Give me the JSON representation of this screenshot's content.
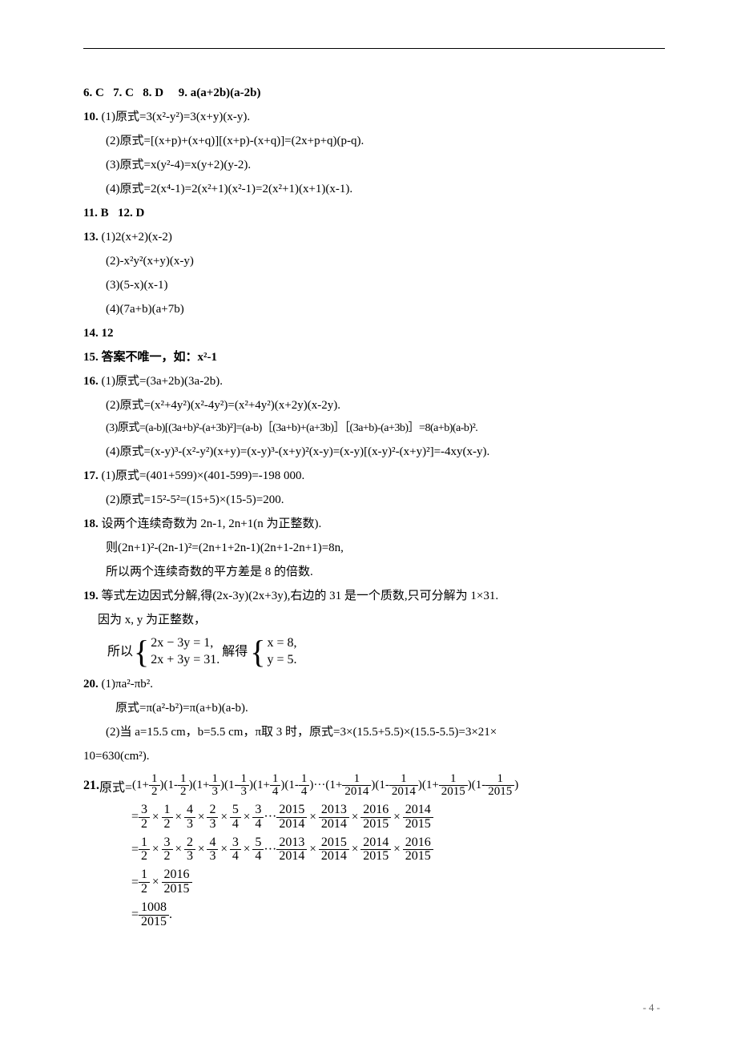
{
  "page_number_text": "- 4 -",
  "ans6": "6. C",
  "ans7": "7. C",
  "ans8": "8. D",
  "ans9": "9. a(a+2b)(a-2b)",
  "q10": {
    "label": "10.",
    "p1": "(1)原式=3(x²-y²)=3(x+y)(x-y).",
    "p2": "(2)原式=[(x+p)+(x+q)][(x+p)-(x+q)]=(2x+p+q)(p-q).",
    "p3": "(3)原式=x(y²-4)=x(y+2)(y-2).",
    "p4": "(4)原式=2(x⁴-1)=2(x²+1)(x²-1)=2(x²+1)(x+1)(x-1)."
  },
  "ans11": "11. B",
  "ans12": "12. D",
  "q13": {
    "label": "13.",
    "p1": "(1)2(x+2)(x-2)",
    "p2": "(2)-x²y²(x+y)(x-y)",
    "p3": "(3)(5-x)(x-1)",
    "p4": "(4)(7a+b)(a+7b)"
  },
  "ans14": "14. 12",
  "ans15": "15. 答案不唯一，如：x²-1",
  "q16": {
    "label": "16.",
    "p1": "(1)原式=(3a+2b)(3a-2b).",
    "p2": "(2)原式=(x²+4y²)(x²-4y²)=(x²+4y²)(x+2y)(x-2y).",
    "p3": "(3)原式=(a-b)[(3a+b)²-(a+3b)²]=(a-b)［(3a+b)+(a+3b)］［(3a+b)-(a+3b)］=8(a+b)(a-b)².",
    "p4": "(4)原式=(x-y)³-(x²-y²)(x+y)=(x-y)³-(x+y)²(x-y)=(x-y)[(x-y)²-(x+y)²]=-4xy(x-y)."
  },
  "q17": {
    "label": "17.",
    "p1": "(1)原式=(401+599)×(401-599)=-198 000.",
    "p2": "(2)原式=15²-5²=(15+5)×(15-5)=200."
  },
  "q18": {
    "label": "18.",
    "p1": "设两个连续奇数为 2n-1, 2n+1(n 为正整数).",
    "p2": "则(2n+1)²-(2n-1)²=(2n+1+2n-1)(2n+1-2n+1)=8n,",
    "p3": "所以两个连续奇数的平方差是 8 的倍数."
  },
  "q19": {
    "label": "19.",
    "p1": "等式左边因式分解,得(2x-3y)(2x+3y),右边的 31 是一个质数,只可分解为 1×31.",
    "p2": "因为 x, y 为正整数，",
    "so_label": "所以",
    "eq1a": "2x − 3y = 1,",
    "eq1b": "2x + 3y = 31.",
    "solve_label": "解得",
    "eq2a": "x = 8,",
    "eq2b": "y = 5."
  },
  "q20": {
    "label": "20.",
    "p1": "(1)πa²-πb².",
    "p2": "原式=π(a²-b²)=π(a+b)(a-b).",
    "p3a": "(2)当 a=15.5 cm，b=5.5 cm，π取 3 时，原式=3×(15.5+5.5)×(15.5-5.5)=3×21×",
    "p3b": "10=630(cm²)."
  },
  "q21": {
    "label": "21.",
    "prefix": "原式=",
    "row1_text_parts": [
      "(1+",
      "1",
      "2",
      ")(1-",
      "1",
      "2",
      ")(1+",
      "1",
      "3",
      ")(1-",
      "1",
      "3",
      ")(1+",
      "1",
      "4",
      ")(1-",
      "1",
      "4",
      ")···(1+",
      "1",
      "2014",
      ")(1-",
      "1",
      "2014",
      ")(1+",
      "1",
      "2015",
      ")(1-",
      "1",
      "2015",
      ")"
    ],
    "row2": {
      "eq": "=",
      "pairs": [
        [
          "3",
          "2"
        ],
        [
          "1",
          "2"
        ],
        [
          "4",
          "3"
        ],
        [
          "2",
          "3"
        ],
        [
          "5",
          "4"
        ],
        [
          "3",
          "4"
        ]
      ],
      "dots": "···",
      "tail": [
        [
          "2015",
          "2014"
        ],
        [
          "2013",
          "2014"
        ],
        [
          "2016",
          "2015"
        ],
        [
          "2014",
          "2015"
        ]
      ]
    },
    "row3": {
      "eq": "=",
      "pairs": [
        [
          "1",
          "2"
        ],
        [
          "3",
          "2"
        ],
        [
          "2",
          "3"
        ],
        [
          "4",
          "3"
        ],
        [
          "3",
          "4"
        ],
        [
          "5",
          "4"
        ]
      ],
      "dots": "···",
      "tail": [
        [
          "2013",
          "2014"
        ],
        [
          "2015",
          "2014"
        ],
        [
          "2014",
          "2015"
        ],
        [
          "2016",
          "2015"
        ]
      ]
    },
    "row4": {
      "eq": "=",
      "pairs": [
        [
          "1",
          "2"
        ],
        [
          "2016",
          "2015"
        ]
      ]
    },
    "row5": {
      "eq": "=",
      "single": [
        "1008",
        "2015"
      ],
      "period": "."
    }
  }
}
